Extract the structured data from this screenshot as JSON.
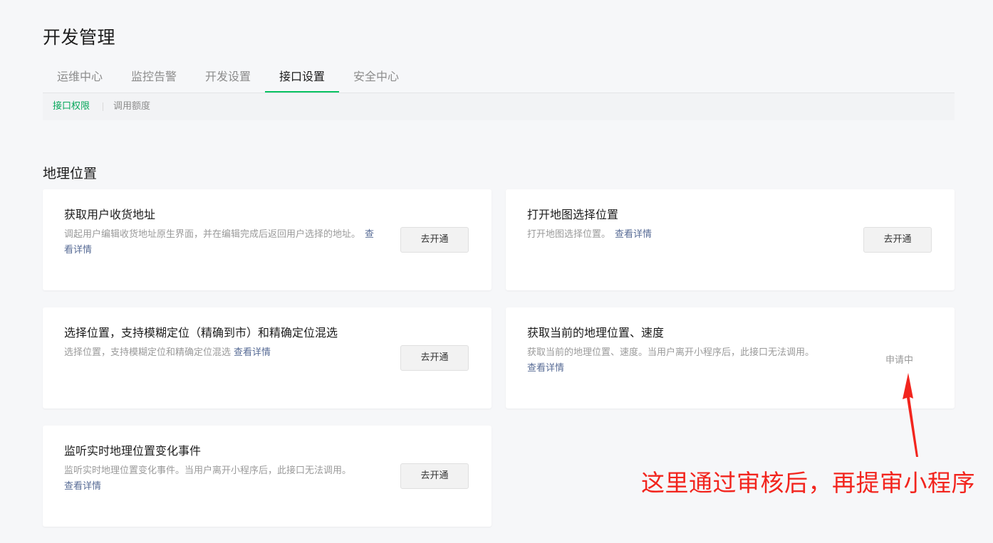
{
  "page": {
    "title": "开发管理"
  },
  "tabs": [
    {
      "label": "运维中心"
    },
    {
      "label": "监控告警"
    },
    {
      "label": "开发设置"
    },
    {
      "label": "接口设置",
      "active": true
    },
    {
      "label": "安全中心"
    }
  ],
  "subnav": [
    {
      "label": "接口权限",
      "active": true
    },
    {
      "label": "调用额度"
    }
  ],
  "section": {
    "title": "地理位置"
  },
  "cards": [
    {
      "title": "获取用户收货地址",
      "desc": "调起用户编辑收货地址原生界面，并在编辑完成后返回用户选择的地址。",
      "link": "查看详情",
      "action": "去开通"
    },
    {
      "title": "打开地图选择位置",
      "desc": "打开地图选择位置。",
      "link": "查看详情",
      "action": "去开通"
    },
    {
      "title": "选择位置，支持模糊定位（精确到市）和精确定位混选",
      "desc": "选择位置，支持模糊定位和精确定位混选",
      "link": "查看详情",
      "action": "去开通"
    },
    {
      "title": "获取当前的地理位置、速度",
      "desc": "获取当前的地理位置、速度。当用户离开小程序后，此接口无法调用。",
      "link": "查看详情",
      "status": "申请中"
    },
    {
      "title": "监听实时地理位置变化事件",
      "desc": "监听实时地理位置变化事件。当用户离开小程序后，此接口无法调用。",
      "link": "查看详情",
      "action": "去开通"
    }
  ],
  "annotation": {
    "text": "这里通过审核后，再提审小程序",
    "color": "#f2251e"
  },
  "colors": {
    "accent": "#07c160",
    "link": "#576b95",
    "background": "#f6f7f9"
  }
}
